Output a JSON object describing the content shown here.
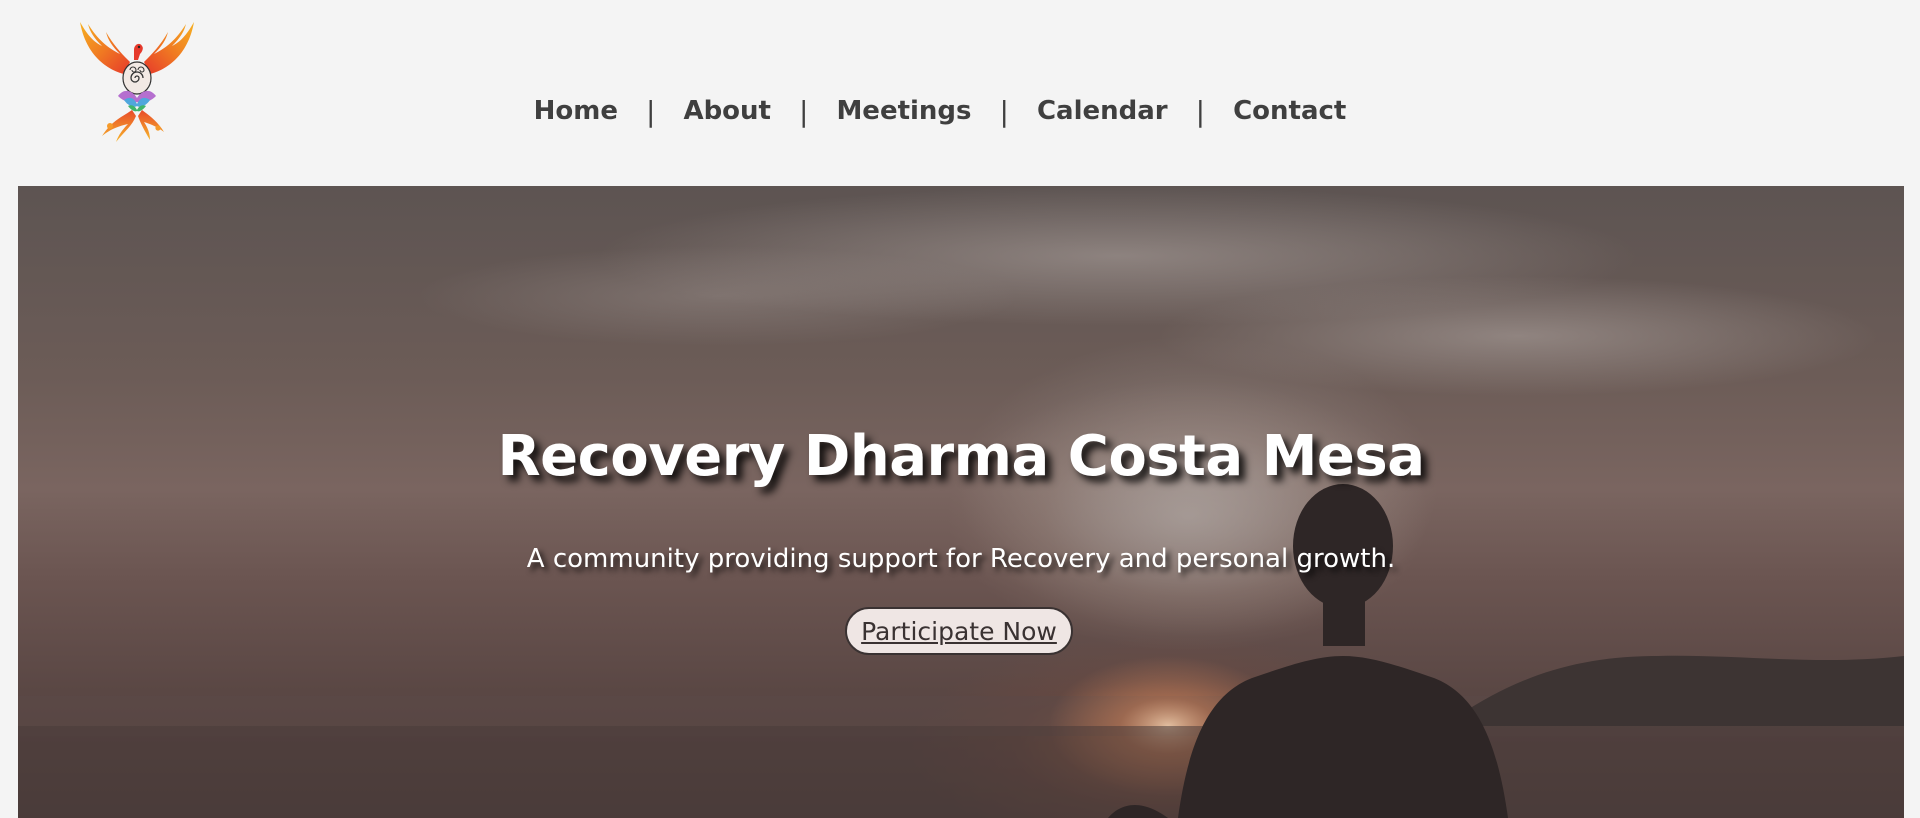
{
  "nav": {
    "items": [
      {
        "label": "Home"
      },
      {
        "label": "About"
      },
      {
        "label": "Meetings"
      },
      {
        "label": "Calendar"
      },
      {
        "label": "Contact"
      }
    ],
    "separator": "|"
  },
  "hero": {
    "title": "Recovery Dharma Costa Mesa",
    "subtitle": "A community providing support for Recovery and personal growth.",
    "cta_label": "Participate Now"
  },
  "icons": {
    "logo": "phoenix-lotus-logo"
  },
  "colors": {
    "page_background": "#f4f4f4",
    "nav_text": "#3f3f3f",
    "hero_text": "#ffffff",
    "cta_background": "#efe6e4",
    "cta_border": "#3a3232"
  }
}
